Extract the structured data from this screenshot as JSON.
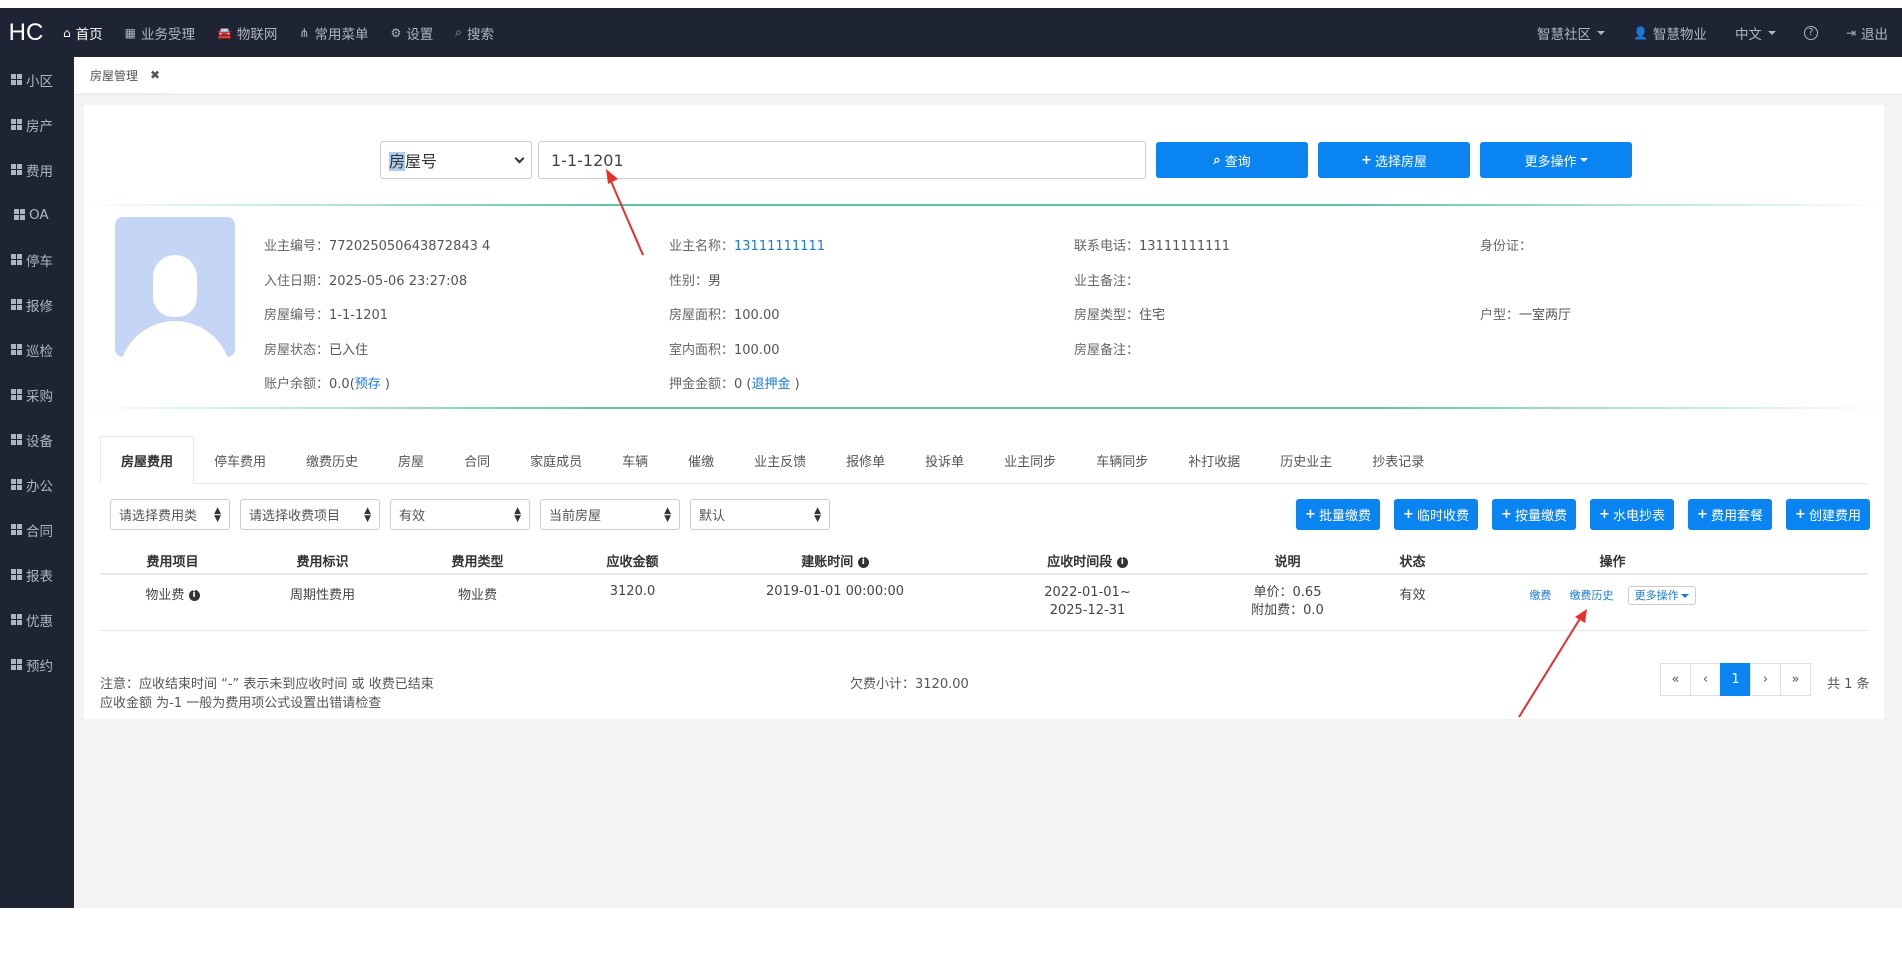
{
  "nav": {
    "logo": "HC",
    "items": [
      {
        "label": "首页",
        "icon": "home-icon"
      },
      {
        "label": "业务受理",
        "icon": "calculator-icon"
      },
      {
        "label": "物联网",
        "icon": "car-icon"
      },
      {
        "label": "常用菜单",
        "icon": "sitemap-icon"
      },
      {
        "label": "设置",
        "icon": "gear-icon"
      },
      {
        "label": "搜索",
        "icon": "search-icon"
      }
    ],
    "right": {
      "community": "智慧社区",
      "user": "智慧物业",
      "language": "中文",
      "help": "?",
      "logout": "退出"
    }
  },
  "sidebar": {
    "items": [
      {
        "label": "小区"
      },
      {
        "label": "房产"
      },
      {
        "label": "费用"
      },
      {
        "label": "OA"
      },
      {
        "label": "停车"
      },
      {
        "label": "报修"
      },
      {
        "label": "巡检"
      },
      {
        "label": "采购"
      },
      {
        "label": "设备"
      },
      {
        "label": "办公"
      },
      {
        "label": "合同"
      },
      {
        "label": "报表"
      },
      {
        "label": "优惠"
      },
      {
        "label": "预约"
      }
    ]
  },
  "page_tab": {
    "label": "房屋管理",
    "close": "✖"
  },
  "search": {
    "select_value_highlight": "房",
    "select_value_rest": "屋号",
    "input_value": "1-1-1201",
    "query_label": "查询",
    "choose_label": "选择房屋",
    "more_label": "更多操作"
  },
  "owner": {
    "owner_no_label": "业主编号：",
    "owner_no": "772025050643872843 4",
    "owner_name_label": "业主名称：",
    "owner_name": "13111111111",
    "phone_label": "联系电话：",
    "phone": "13111111111",
    "id_label": "身份证：",
    "checkin_label": "入住日期：",
    "checkin": "2025-05-06 23:27:08",
    "gender_label": "性别：",
    "gender": "男",
    "owner_note_label": "业主备注：",
    "room_no_label": "房屋编号：",
    "room_no": "1-1-1201",
    "area_label": "房屋面积：",
    "area": "100.00",
    "room_type_label": "房屋类型：",
    "room_type": "住宅",
    "layout_label": "户型：",
    "layout": "一室两厅",
    "status_label": "房屋状态：",
    "status": "已入住",
    "inner_area_label": "室内面积：",
    "inner_area": "100.00",
    "room_note_label": "房屋备注：",
    "balance_label": "账户余额：",
    "balance": "0.0(",
    "balance_link": "预存",
    "balance_close": " )",
    "deposit_label": "押金金额：",
    "deposit": "0 (",
    "deposit_link": "退押金",
    "deposit_close": " )"
  },
  "tabs": [
    "房屋费用",
    "停车费用",
    "缴费历史",
    "房屋",
    "合同",
    "家庭成员",
    "车辆",
    "催缴",
    "业主反馈",
    "报修单",
    "投诉单",
    "业主同步",
    "车辆同步",
    "补打收据",
    "历史业主",
    "抄表记录"
  ],
  "filters": [
    "请选择费用类",
    "请选择收费项目",
    "有效",
    "当前房屋",
    "默认"
  ],
  "actions": [
    "批量缴费",
    "临时收费",
    "按量缴费",
    "水电抄表",
    "费用套餐",
    "创建费用"
  ],
  "table": {
    "headers": [
      "费用项目",
      "费用标识",
      "费用类型",
      "应收金额",
      "建账时间",
      "应收时间段",
      "说明",
      "状态",
      "操作"
    ],
    "row": {
      "item": "物业费",
      "flag": "周期性费用",
      "type": "物业费",
      "amount": "3120.0",
      "created": "2019-01-01 00:00:00",
      "period_1": "2022-01-01~",
      "period_2": "2025-12-31",
      "desc_1": "单价：0.65",
      "desc_2": "附加费：0.0",
      "status": "有效",
      "op_pay": "缴费",
      "op_history": "缴费历史",
      "op_more": "更多操作"
    }
  },
  "notes": {
    "line1": "注意：应收结束时间 “-” 表示未到应收时间 或 收费已结束",
    "line2": "应收金额 为-1 一般为费用项公式设置出错请检查",
    "arrears": "欠费小计：3120.00"
  },
  "pagination": {
    "first": "«",
    "prev": "‹",
    "current": "1",
    "next": "›",
    "last": "»",
    "total": "共 1 条"
  },
  "colors": {
    "nav_bg": "#1f2434",
    "primary": "#0a84f0",
    "link": "#1a7bd6",
    "annotation_arrow": "#e8302a"
  }
}
